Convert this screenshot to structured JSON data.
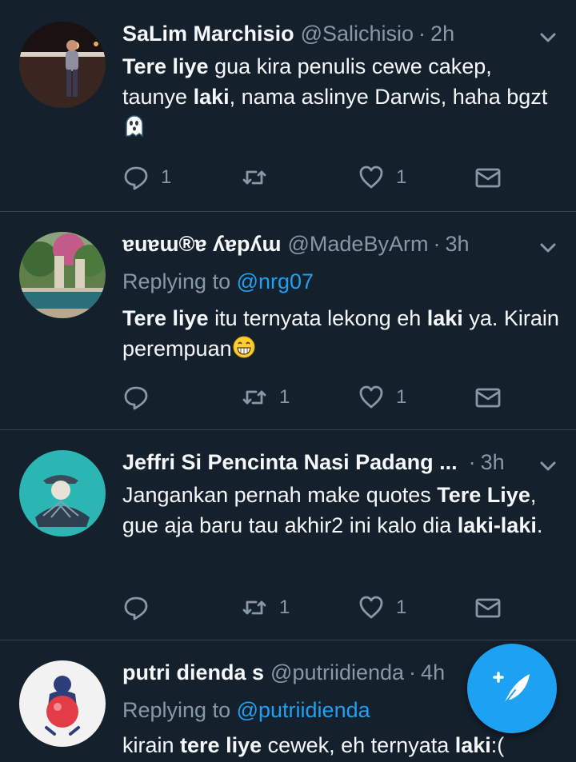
{
  "tweets": [
    {
      "name": "SaLim Marchisio",
      "handle": "@Salichisio",
      "separator": "·",
      "time": "2h",
      "replying_prefix": "",
      "replying_to": "",
      "body_parts": [
        {
          "t": "Tere liye",
          "b": true
        },
        {
          "t": " gua kira penulis cewe cakep, taunye ",
          "b": false
        },
        {
          "t": "laki",
          "b": true
        },
        {
          "t": ", nama aslinye Darwis, haha bgzt ",
          "b": false
        }
      ],
      "emoji": "ghost-emoji",
      "reply_count": "1",
      "retweet_count": "",
      "like_count": "1"
    },
    {
      "name": "ɐuɐɯ®ɐ ʎɐpʎɯ",
      "handle": "@MadeByArm",
      "separator": "·",
      "time": "3h",
      "replying_prefix": "Replying to",
      "replying_to": "@nrg07",
      "body_parts": [
        {
          "t": "Tere liye",
          "b": true
        },
        {
          "t": " itu ternyata lekong eh ",
          "b": false
        },
        {
          "t": "laki",
          "b": true
        },
        {
          "t": " ya. Kirain perempuan",
          "b": false
        }
      ],
      "emoji": "grin-emoji",
      "reply_count": "",
      "retweet_count": "1",
      "like_count": "1"
    },
    {
      "name": "Jeffri Si Pencinta Nasi Padang ...",
      "handle": "",
      "separator": "·",
      "time": "3h",
      "replying_prefix": "",
      "replying_to": "",
      "body_parts": [
        {
          "t": "Jangankan pernah make quotes ",
          "b": false
        },
        {
          "t": "Tere Liye",
          "b": true
        },
        {
          "t": ", gue aja baru tau akhir2 ini kalo dia ",
          "b": false
        },
        {
          "t": "laki-laki",
          "b": true
        },
        {
          "t": ".",
          "b": false
        }
      ],
      "emoji": "",
      "reply_count": "",
      "retweet_count": "1",
      "like_count": "1"
    },
    {
      "name": "putri dienda s",
      "handle": "@putriidienda",
      "separator": "·",
      "time": "4h",
      "replying_prefix": "Replying to",
      "replying_to": "@putriidienda",
      "body_parts": [
        {
          "t": "kirain ",
          "b": false
        },
        {
          "t": "tere liye",
          "b": true
        },
        {
          "t": " cewek, eh ternyata ",
          "b": false
        },
        {
          "t": "laki",
          "b": true
        },
        {
          "t": ":(",
          "b": false
        }
      ],
      "emoji": "",
      "reply_count": "",
      "retweet_count": "",
      "like_count": ""
    }
  ],
  "icons": {
    "reply": "reply-icon",
    "retweet": "retweet-icon",
    "like": "heart-icon",
    "dm": "envelope-icon",
    "caret": "chevron-down-icon",
    "compose": "compose-tweet-icon"
  },
  "colors": {
    "background": "#14202b",
    "divider": "#38444d",
    "muted": "#8899a6",
    "accent": "#1da1f2",
    "text": "#f5f8fa"
  }
}
